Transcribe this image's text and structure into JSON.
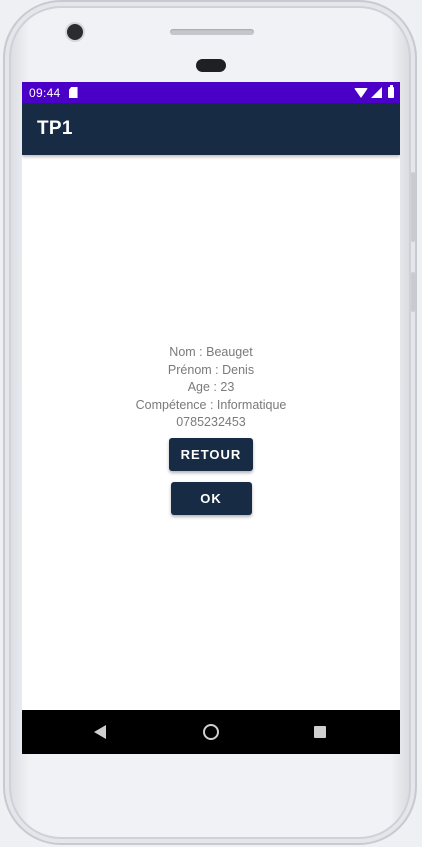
{
  "status_bar": {
    "time": "09:44",
    "icons": [
      "sd-card-icon",
      "wifi-icon",
      "signal-icon",
      "battery-icon"
    ],
    "color": "#4a00c7"
  },
  "app_bar": {
    "title": "TP1",
    "color": "#172b45"
  },
  "profile": {
    "nom": "Nom : Beauget",
    "prenom": "Prénom : Denis",
    "age": "Age : 23",
    "competence": "Compétence : Informatique",
    "telephone": "0785232453"
  },
  "buttons": {
    "retour_label": "RETOUR",
    "ok_label": "OK"
  },
  "nav_bar": {
    "icons": [
      "back-icon",
      "home-icon",
      "recents-icon"
    ]
  }
}
